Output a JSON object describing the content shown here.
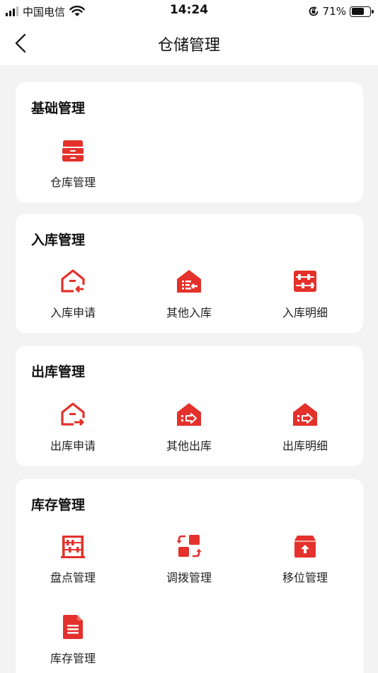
{
  "status_bar": {
    "carrier": "中国电信",
    "time": "14:24",
    "battery_percent": "71%",
    "battery_level": 0.71
  },
  "nav": {
    "title": "仓储管理",
    "back_icon": "chevron-left-icon"
  },
  "accent_color": "#e4312b",
  "sections": [
    {
      "title": "基础管理",
      "items": [
        {
          "label": "仓库管理",
          "icon": "drawer-box-icon"
        }
      ]
    },
    {
      "title": "入库管理",
      "items": [
        {
          "label": "入库申请",
          "icon": "house-in-arrow-icon"
        },
        {
          "label": "其他入库",
          "icon": "house-list-in-icon"
        },
        {
          "label": "入库明细",
          "icon": "abacus-icon"
        }
      ]
    },
    {
      "title": "出库管理",
      "items": [
        {
          "label": "出库申请",
          "icon": "house-out-arrow-icon"
        },
        {
          "label": "其他出库",
          "icon": "house-out-icon"
        },
        {
          "label": "出库明细",
          "icon": "house-out-detail-icon"
        }
      ]
    },
    {
      "title": "库存管理",
      "items": [
        {
          "label": "盘点管理",
          "icon": "abacus-frame-icon"
        },
        {
          "label": "调拨管理",
          "icon": "transfer-swap-icon"
        },
        {
          "label": "移位管理",
          "icon": "box-up-arrow-icon"
        },
        {
          "label": "库存管理",
          "icon": "document-icon"
        }
      ]
    }
  ]
}
